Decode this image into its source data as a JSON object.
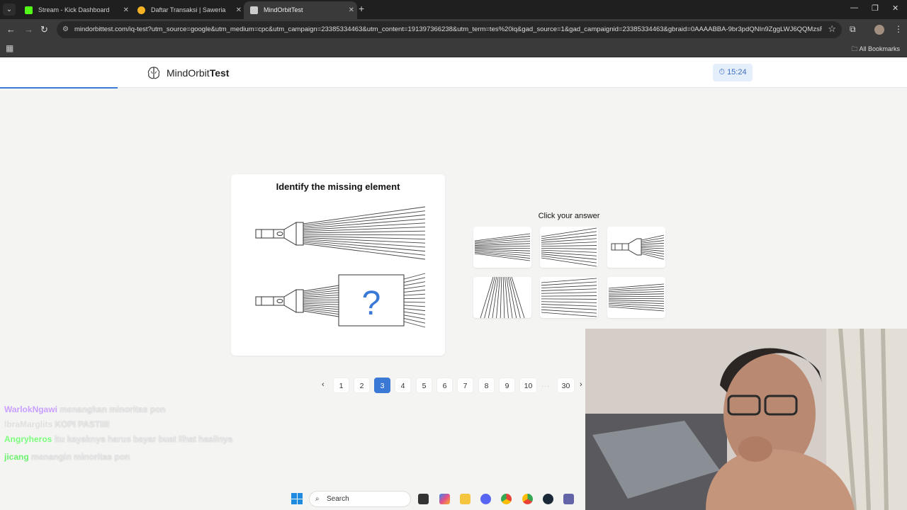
{
  "browser": {
    "tabs": [
      {
        "title": "Stream - Kick Dashboard",
        "color": "#53fc18"
      },
      {
        "title": "Daftar Transaksi | Saweria",
        "color": "#f5b324"
      },
      {
        "title": "MindOrbitTest",
        "color": "#cccccc"
      }
    ],
    "url": "mindorbittest.com/iq-test?utm_source=google&utm_medium=cpc&utm_campaign=23385334463&utm_content=191397366238&utm_term=tes%20iq&gad_source=1&gad_campaignid=23385334463&gbraid=0AAAABBA-9br3pdQNIn9ZggLWJ6QQMzsR...",
    "bookmarks_label": "All Bookmarks"
  },
  "header": {
    "brand_regular": "MindOrbit",
    "brand_bold": "Test",
    "timer": "15:24",
    "progress_fraction": 0.13
  },
  "question": {
    "title": "Identify the missing element",
    "missing_symbol": "?"
  },
  "answers": {
    "prompt": "Click your answer",
    "options": [
      "option-1",
      "option-2",
      "option-3",
      "option-4",
      "option-5",
      "option-6"
    ]
  },
  "pagination": {
    "pages": [
      "1",
      "2",
      "3",
      "4",
      "5",
      "6",
      "7",
      "8",
      "9",
      "10"
    ],
    "current": "3",
    "ellipsis": "...",
    "last": "30",
    "prev": "‹",
    "next": "›"
  },
  "chat": [
    {
      "user": "WarlokNgawi",
      "message": "menangkan minoritas pon",
      "color": "#c9a0ff"
    },
    {
      "user": "IbraMarglits",
      "message": "KOPI PASTIIII",
      "color": "#d8d8d8"
    },
    {
      "user": "Angryheros",
      "message": "itu kayaknya harus bayar buat lihat hasilnya",
      "color": "#7cff7c"
    },
    {
      "user": "jicang",
      "message": "menangin minoritas pon",
      "color": "#6cf16c"
    }
  ],
  "taskbar": {
    "search_placeholder": "Search"
  }
}
